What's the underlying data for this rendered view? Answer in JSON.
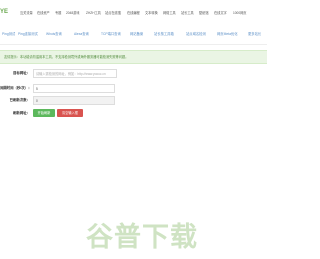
{
  "nav": {
    "logo": "YE",
    "links": [
      "互关流量",
      "在线资产",
      "专题",
      "2048游戏",
      "ZHZH工具",
      "站点在线搜",
      "在线编程",
      "文本转换",
      "网络工具",
      "站长工具",
      "壁纸馆",
      "在线文字",
      "1000网页"
    ]
  },
  "tools": {
    "tabs": [
      "Ping测试",
      "Ping连接测试",
      "Whois查询",
      "Alexa查询",
      "TCP端口查询",
      "网站备案",
      "站长核工具箱",
      "站点域名检测",
      "网页Meta优化",
      "更多站长"
    ]
  },
  "notice": {
    "text": "友情提示：本功能请勿滥用本工具，不支持检测境外或海外服务器可能检测失败等问题。"
  },
  "form": {
    "url_label": "目标网址：",
    "url_placeholder": "请输入需检测的网址，例如：http://www.yoouc.cn",
    "interval_label": "间隔时间（秒/次）：",
    "interval_value": "5",
    "count_label": "已刷新次数：",
    "count_value": "0",
    "action_label": "刷新网址：",
    "start_label": "开始刷新",
    "clear_label": "清空输入框"
  },
  "watermark": {
    "text": "谷普下载"
  },
  "colors": {
    "brand": "#6aa84f",
    "link": "#5b8fc7",
    "start": "#5cb85c",
    "clear": "#d9534f"
  }
}
